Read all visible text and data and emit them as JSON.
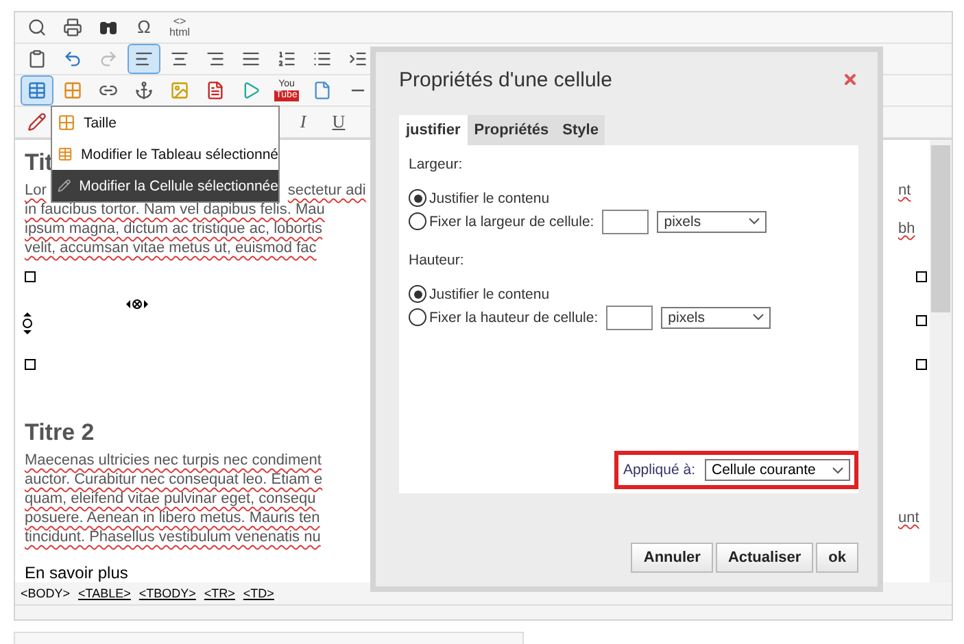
{
  "toolbar_rows": [
    [
      {
        "kind": "zoom",
        "selected": false
      },
      {
        "kind": "print",
        "selected": false
      },
      {
        "kind": "binoculars",
        "selected": false
      },
      {
        "kind": "text",
        "label": "Ω",
        "selected": false
      },
      {
        "kind": "html",
        "label": "<>",
        "sublabel": "html",
        "selected": false
      }
    ],
    [
      {
        "kind": "paste",
        "selected": false
      },
      {
        "kind": "undo",
        "selected": false
      },
      {
        "kind": "redo",
        "selected": false
      },
      {
        "kind": "align-left",
        "selected": true
      },
      {
        "kind": "align-center",
        "selected": false
      },
      {
        "kind": "align-right",
        "selected": false
      },
      {
        "kind": "justify",
        "selected": false
      },
      {
        "kind": "ordered-list",
        "selected": false
      },
      {
        "kind": "bullet-list",
        "selected": false
      },
      {
        "kind": "indent",
        "selected": false
      }
    ],
    [
      {
        "kind": "table",
        "selected": true
      },
      {
        "kind": "table-edit",
        "selected": false
      },
      {
        "kind": "link",
        "selected": false
      },
      {
        "kind": "anchor",
        "selected": false
      },
      {
        "kind": "image",
        "selected": false
      },
      {
        "kind": "flash",
        "selected": false
      },
      {
        "kind": "media",
        "selected": false
      },
      {
        "kind": "youtube",
        "label": "You",
        "sublabel": "Tube",
        "selected": false
      },
      {
        "kind": "file",
        "selected": false
      },
      {
        "kind": "rule",
        "selected": false
      }
    ],
    [
      {
        "kind": "pencil",
        "selected": false
      },
      {
        "kind": "gap"
      },
      {
        "kind": "gap"
      },
      {
        "kind": "gap"
      },
      {
        "kind": "gap"
      },
      {
        "kind": "gap"
      },
      {
        "kind": "gap"
      },
      {
        "kind": "gap"
      },
      {
        "kind": "text-italic",
        "label": "I",
        "selected": false
      },
      {
        "kind": "text-underline",
        "label": "U",
        "selected": false
      }
    ]
  ],
  "menu": {
    "items": [
      {
        "label": "Taille",
        "selected": false
      },
      {
        "label": "Modifier le Tableau sélectionné",
        "selected": false
      },
      {
        "label": "Modifier la Cellule sélectionnée",
        "selected": true
      }
    ]
  },
  "editor": {
    "heading_1": "Tit",
    "paragraph_1": [
      {
        "parts": [
          "Lor",
          "sectetur adi"
        ],
        "right": "nt"
      },
      {
        "parts": [
          "in faucibus tortor. Nam vel dapibus felis. Mau"
        ]
      },
      {
        "parts": [
          "ipsum magna, dictum ac tristique ac, lobortis"
        ],
        "right": "bh"
      },
      {
        "parts": [
          "velit, accumsan vitae metus ut, euismod fac"
        ]
      }
    ],
    "heading_2": "Titre 2",
    "paragraph_2": [
      {
        "parts": [
          "Maecenas ultricies nec turpis nec condiment"
        ]
      },
      {
        "parts": [
          "auctor. Curabitur nec consequat leo. Etiam e"
        ]
      },
      {
        "parts": [
          "quam, eleifend vitae pulvinar eget, consequ"
        ]
      },
      {
        "parts": [
          "posuere. Aenean in libero metus. Mauris ten"
        ],
        "right": "unt"
      },
      {
        "parts": [
          "tincidunt. Phasellus vestibulum venenatis nu"
        ]
      }
    ],
    "link_text": "En savoir plus"
  },
  "path_bar": [
    {
      "tag": "<BODY>",
      "underlined": false
    },
    {
      "tag": "<TABLE>",
      "underlined": true
    },
    {
      "tag": "<TBODY>",
      "underlined": true
    },
    {
      "tag": "<TR>",
      "underlined": true
    },
    {
      "tag": "<TD>",
      "underlined": true
    }
  ],
  "dialog": {
    "title": "Propriétés d'une cellule",
    "tabs": [
      {
        "label": "justifier",
        "selected": true
      },
      {
        "label": "Propriétés",
        "selected": false
      },
      {
        "label": "Style",
        "selected": false
      }
    ],
    "sections": [
      {
        "label": "Largeur:",
        "options": [
          {
            "label": "Justifier le contenu",
            "checked": true
          },
          {
            "label": "Fixer la largeur de cellule:",
            "checked": false
          }
        ],
        "unit": "pixels"
      },
      {
        "label": "Hauteur:",
        "options": [
          {
            "label": "Justifier le contenu",
            "checked": true
          },
          {
            "label": "Fixer la hauteur de cellule:",
            "checked": false
          }
        ],
        "unit": "pixels"
      }
    ],
    "apply_label": "Appliqué à:",
    "apply_value": "Cellule courante",
    "buttons": [
      "Annuler",
      "Actualiser",
      "ok"
    ]
  }
}
